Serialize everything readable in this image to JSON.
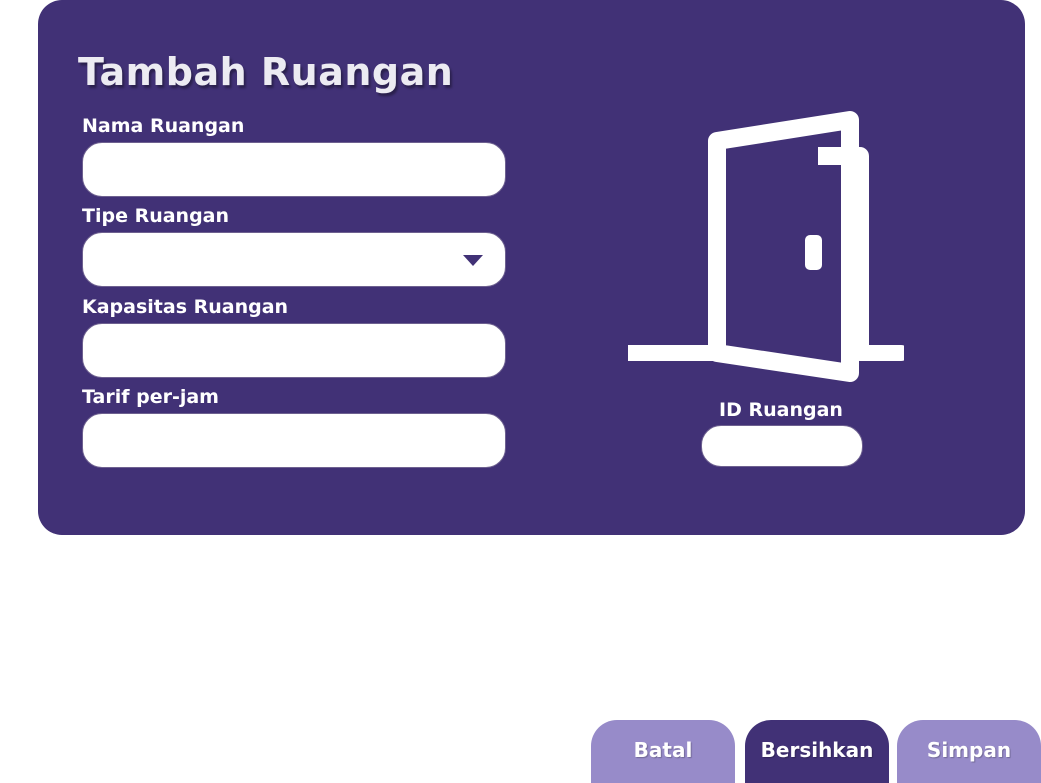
{
  "form": {
    "title": "Tambah Ruangan",
    "fields": [
      {
        "label": "Nama Ruangan",
        "value": ""
      },
      {
        "label": "Tipe Ruangan",
        "value": ""
      },
      {
        "label": "Kapasitas Ruangan",
        "value": ""
      },
      {
        "label": "Tarif per-jam",
        "value": ""
      }
    ],
    "room_id": {
      "label": "ID Ruangan",
      "value": ""
    },
    "icon": "door-open-icon"
  },
  "actions": {
    "cancel_label": "Batal",
    "clear_label": "Bersihkan",
    "save_label": "Simpan"
  },
  "colors": {
    "panel": "#413176",
    "button_light": "#978bc9",
    "button_dark": "#413176",
    "text": "#ffffff"
  }
}
